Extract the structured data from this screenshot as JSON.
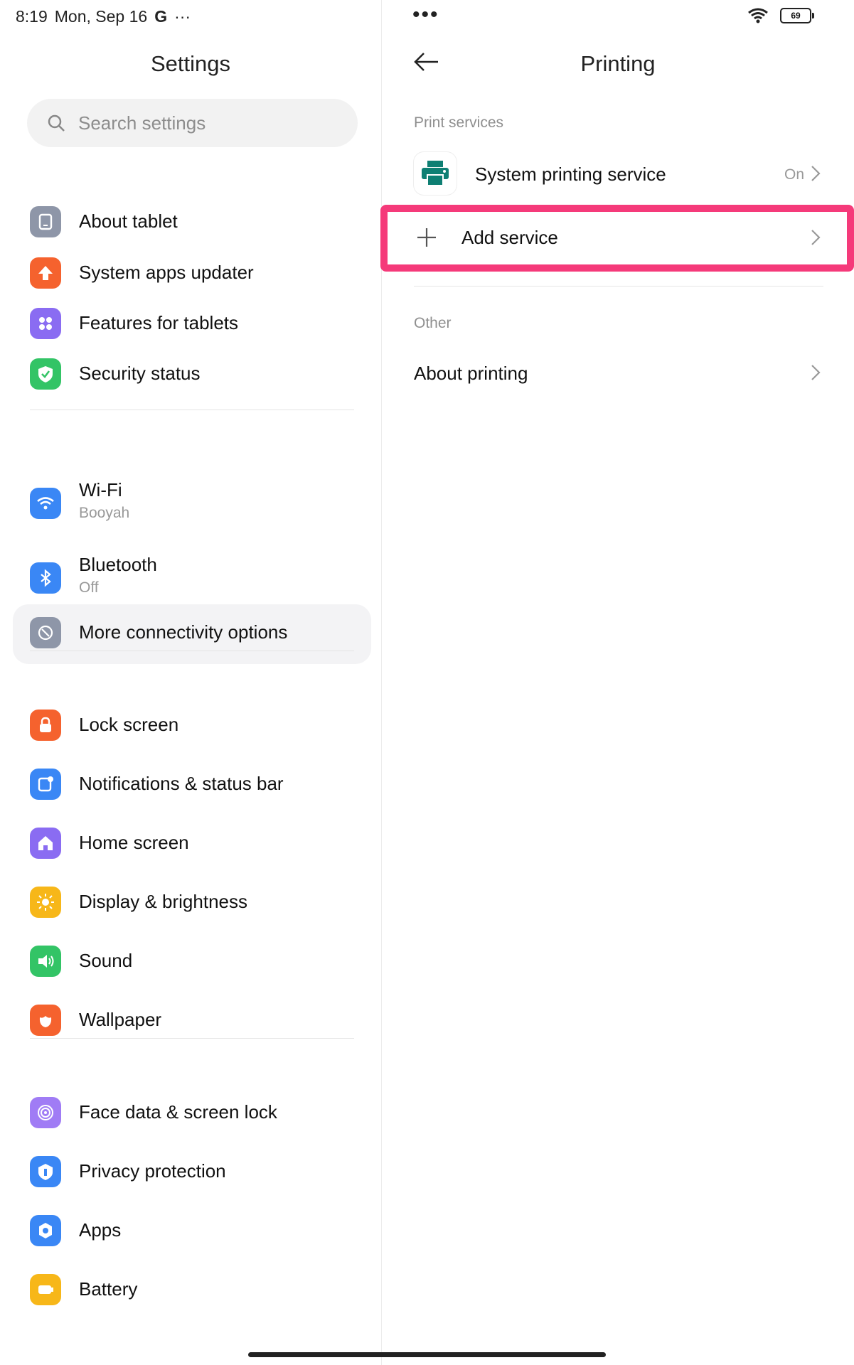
{
  "status": {
    "time": "8:19",
    "date": "Mon, Sep 16",
    "g": "G",
    "more": "···",
    "battery": "69"
  },
  "right_dots": "•••",
  "settings": {
    "title": "Settings",
    "search_placeholder": "Search settings",
    "groups": [
      [
        {
          "label": "About tablet",
          "icon": "tablet-icon",
          "color": "#8e96a8"
        },
        {
          "label": "System apps updater",
          "icon": "arrow-up-icon",
          "color": "#f5622e"
        },
        {
          "label": "Features for tablets",
          "icon": "grid-icon",
          "color": "#8a6cf2"
        },
        {
          "label": "Security status",
          "icon": "shield-check-icon",
          "color": "#33c466"
        }
      ],
      [
        {
          "label": "Wi-Fi",
          "sub": "Booyah",
          "icon": "wifi-icon",
          "color": "#3a87f5"
        },
        {
          "label": "Bluetooth",
          "sub": "Off",
          "icon": "bluetooth-icon",
          "color": "#3a87f5"
        },
        {
          "label": "More connectivity options",
          "icon": "link-icon",
          "color": "#8e96a8"
        }
      ],
      [
        {
          "label": "Lock screen",
          "icon": "lock-icon",
          "color": "#f5622e"
        },
        {
          "label": "Notifications & status bar",
          "icon": "notification-icon",
          "color": "#3a87f5"
        },
        {
          "label": "Home screen",
          "icon": "home-icon",
          "color": "#8a6cf2"
        },
        {
          "label": "Display & brightness",
          "icon": "sun-icon",
          "color": "#f7b719"
        },
        {
          "label": "Sound",
          "icon": "speaker-icon",
          "color": "#33c466"
        },
        {
          "label": "Wallpaper",
          "icon": "flower-icon",
          "color": "#f5622e"
        }
      ],
      [
        {
          "label": "Face data & screen lock",
          "icon": "fingerprint-icon",
          "color": "#a07cf5"
        },
        {
          "label": "Privacy protection",
          "icon": "privacy-icon",
          "color": "#3a87f5"
        },
        {
          "label": "Apps",
          "icon": "gear-icon",
          "color": "#3a87f5"
        },
        {
          "label": "Battery",
          "icon": "battery-icon",
          "color": "#f7b719"
        }
      ]
    ]
  },
  "printing": {
    "title": "Printing",
    "section_services": "Print services",
    "service_name": "System printing service",
    "service_status": "On",
    "add_service": "Add service",
    "section_other": "Other",
    "about_printing": "About printing",
    "highlight_color": "#f53a7a"
  }
}
